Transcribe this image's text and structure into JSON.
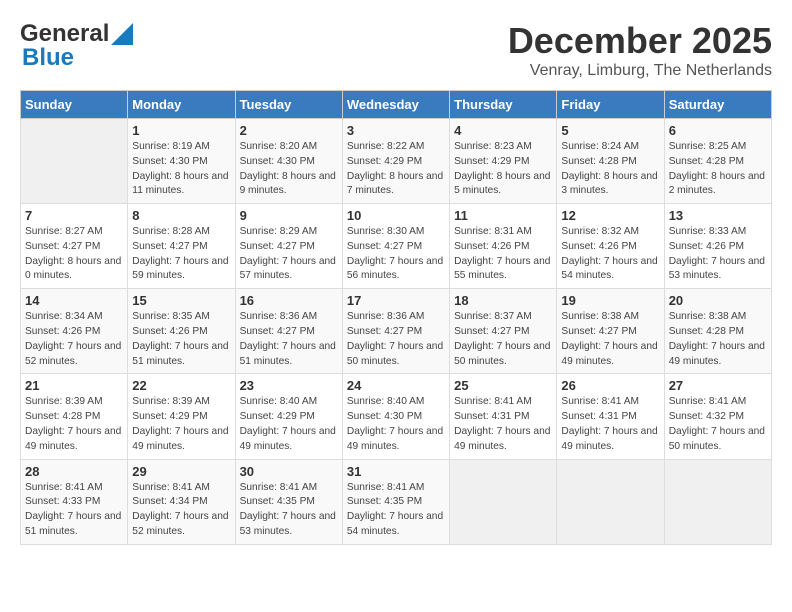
{
  "header": {
    "logo_general": "General",
    "logo_blue": "Blue",
    "month": "December 2025",
    "location": "Venray, Limburg, The Netherlands"
  },
  "weekdays": [
    "Sunday",
    "Monday",
    "Tuesday",
    "Wednesday",
    "Thursday",
    "Friday",
    "Saturday"
  ],
  "weeks": [
    [
      {
        "day": "",
        "sunrise": "",
        "sunset": "",
        "daylight": ""
      },
      {
        "day": "1",
        "sunrise": "Sunrise: 8:19 AM",
        "sunset": "Sunset: 4:30 PM",
        "daylight": "Daylight: 8 hours and 11 minutes."
      },
      {
        "day": "2",
        "sunrise": "Sunrise: 8:20 AM",
        "sunset": "Sunset: 4:30 PM",
        "daylight": "Daylight: 8 hours and 9 minutes."
      },
      {
        "day": "3",
        "sunrise": "Sunrise: 8:22 AM",
        "sunset": "Sunset: 4:29 PM",
        "daylight": "Daylight: 8 hours and 7 minutes."
      },
      {
        "day": "4",
        "sunrise": "Sunrise: 8:23 AM",
        "sunset": "Sunset: 4:29 PM",
        "daylight": "Daylight: 8 hours and 5 minutes."
      },
      {
        "day": "5",
        "sunrise": "Sunrise: 8:24 AM",
        "sunset": "Sunset: 4:28 PM",
        "daylight": "Daylight: 8 hours and 3 minutes."
      },
      {
        "day": "6",
        "sunrise": "Sunrise: 8:25 AM",
        "sunset": "Sunset: 4:28 PM",
        "daylight": "Daylight: 8 hours and 2 minutes."
      }
    ],
    [
      {
        "day": "7",
        "sunrise": "Sunrise: 8:27 AM",
        "sunset": "Sunset: 4:27 PM",
        "daylight": "Daylight: 8 hours and 0 minutes."
      },
      {
        "day": "8",
        "sunrise": "Sunrise: 8:28 AM",
        "sunset": "Sunset: 4:27 PM",
        "daylight": "Daylight: 7 hours and 59 minutes."
      },
      {
        "day": "9",
        "sunrise": "Sunrise: 8:29 AM",
        "sunset": "Sunset: 4:27 PM",
        "daylight": "Daylight: 7 hours and 57 minutes."
      },
      {
        "day": "10",
        "sunrise": "Sunrise: 8:30 AM",
        "sunset": "Sunset: 4:27 PM",
        "daylight": "Daylight: 7 hours and 56 minutes."
      },
      {
        "day": "11",
        "sunrise": "Sunrise: 8:31 AM",
        "sunset": "Sunset: 4:26 PM",
        "daylight": "Daylight: 7 hours and 55 minutes."
      },
      {
        "day": "12",
        "sunrise": "Sunrise: 8:32 AM",
        "sunset": "Sunset: 4:26 PM",
        "daylight": "Daylight: 7 hours and 54 minutes."
      },
      {
        "day": "13",
        "sunrise": "Sunrise: 8:33 AM",
        "sunset": "Sunset: 4:26 PM",
        "daylight": "Daylight: 7 hours and 53 minutes."
      }
    ],
    [
      {
        "day": "14",
        "sunrise": "Sunrise: 8:34 AM",
        "sunset": "Sunset: 4:26 PM",
        "daylight": "Daylight: 7 hours and 52 minutes."
      },
      {
        "day": "15",
        "sunrise": "Sunrise: 8:35 AM",
        "sunset": "Sunset: 4:26 PM",
        "daylight": "Daylight: 7 hours and 51 minutes."
      },
      {
        "day": "16",
        "sunrise": "Sunrise: 8:36 AM",
        "sunset": "Sunset: 4:27 PM",
        "daylight": "Daylight: 7 hours and 51 minutes."
      },
      {
        "day": "17",
        "sunrise": "Sunrise: 8:36 AM",
        "sunset": "Sunset: 4:27 PM",
        "daylight": "Daylight: 7 hours and 50 minutes."
      },
      {
        "day": "18",
        "sunrise": "Sunrise: 8:37 AM",
        "sunset": "Sunset: 4:27 PM",
        "daylight": "Daylight: 7 hours and 50 minutes."
      },
      {
        "day": "19",
        "sunrise": "Sunrise: 8:38 AM",
        "sunset": "Sunset: 4:27 PM",
        "daylight": "Daylight: 7 hours and 49 minutes."
      },
      {
        "day": "20",
        "sunrise": "Sunrise: 8:38 AM",
        "sunset": "Sunset: 4:28 PM",
        "daylight": "Daylight: 7 hours and 49 minutes."
      }
    ],
    [
      {
        "day": "21",
        "sunrise": "Sunrise: 8:39 AM",
        "sunset": "Sunset: 4:28 PM",
        "daylight": "Daylight: 7 hours and 49 minutes."
      },
      {
        "day": "22",
        "sunrise": "Sunrise: 8:39 AM",
        "sunset": "Sunset: 4:29 PM",
        "daylight": "Daylight: 7 hours and 49 minutes."
      },
      {
        "day": "23",
        "sunrise": "Sunrise: 8:40 AM",
        "sunset": "Sunset: 4:29 PM",
        "daylight": "Daylight: 7 hours and 49 minutes."
      },
      {
        "day": "24",
        "sunrise": "Sunrise: 8:40 AM",
        "sunset": "Sunset: 4:30 PM",
        "daylight": "Daylight: 7 hours and 49 minutes."
      },
      {
        "day": "25",
        "sunrise": "Sunrise: 8:41 AM",
        "sunset": "Sunset: 4:31 PM",
        "daylight": "Daylight: 7 hours and 49 minutes."
      },
      {
        "day": "26",
        "sunrise": "Sunrise: 8:41 AM",
        "sunset": "Sunset: 4:31 PM",
        "daylight": "Daylight: 7 hours and 49 minutes."
      },
      {
        "day": "27",
        "sunrise": "Sunrise: 8:41 AM",
        "sunset": "Sunset: 4:32 PM",
        "daylight": "Daylight: 7 hours and 50 minutes."
      }
    ],
    [
      {
        "day": "28",
        "sunrise": "Sunrise: 8:41 AM",
        "sunset": "Sunset: 4:33 PM",
        "daylight": "Daylight: 7 hours and 51 minutes."
      },
      {
        "day": "29",
        "sunrise": "Sunrise: 8:41 AM",
        "sunset": "Sunset: 4:34 PM",
        "daylight": "Daylight: 7 hours and 52 minutes."
      },
      {
        "day": "30",
        "sunrise": "Sunrise: 8:41 AM",
        "sunset": "Sunset: 4:35 PM",
        "daylight": "Daylight: 7 hours and 53 minutes."
      },
      {
        "day": "31",
        "sunrise": "Sunrise: 8:41 AM",
        "sunset": "Sunset: 4:35 PM",
        "daylight": "Daylight: 7 hours and 54 minutes."
      },
      {
        "day": "",
        "sunrise": "",
        "sunset": "",
        "daylight": ""
      },
      {
        "day": "",
        "sunrise": "",
        "sunset": "",
        "daylight": ""
      },
      {
        "day": "",
        "sunrise": "",
        "sunset": "",
        "daylight": ""
      }
    ]
  ]
}
